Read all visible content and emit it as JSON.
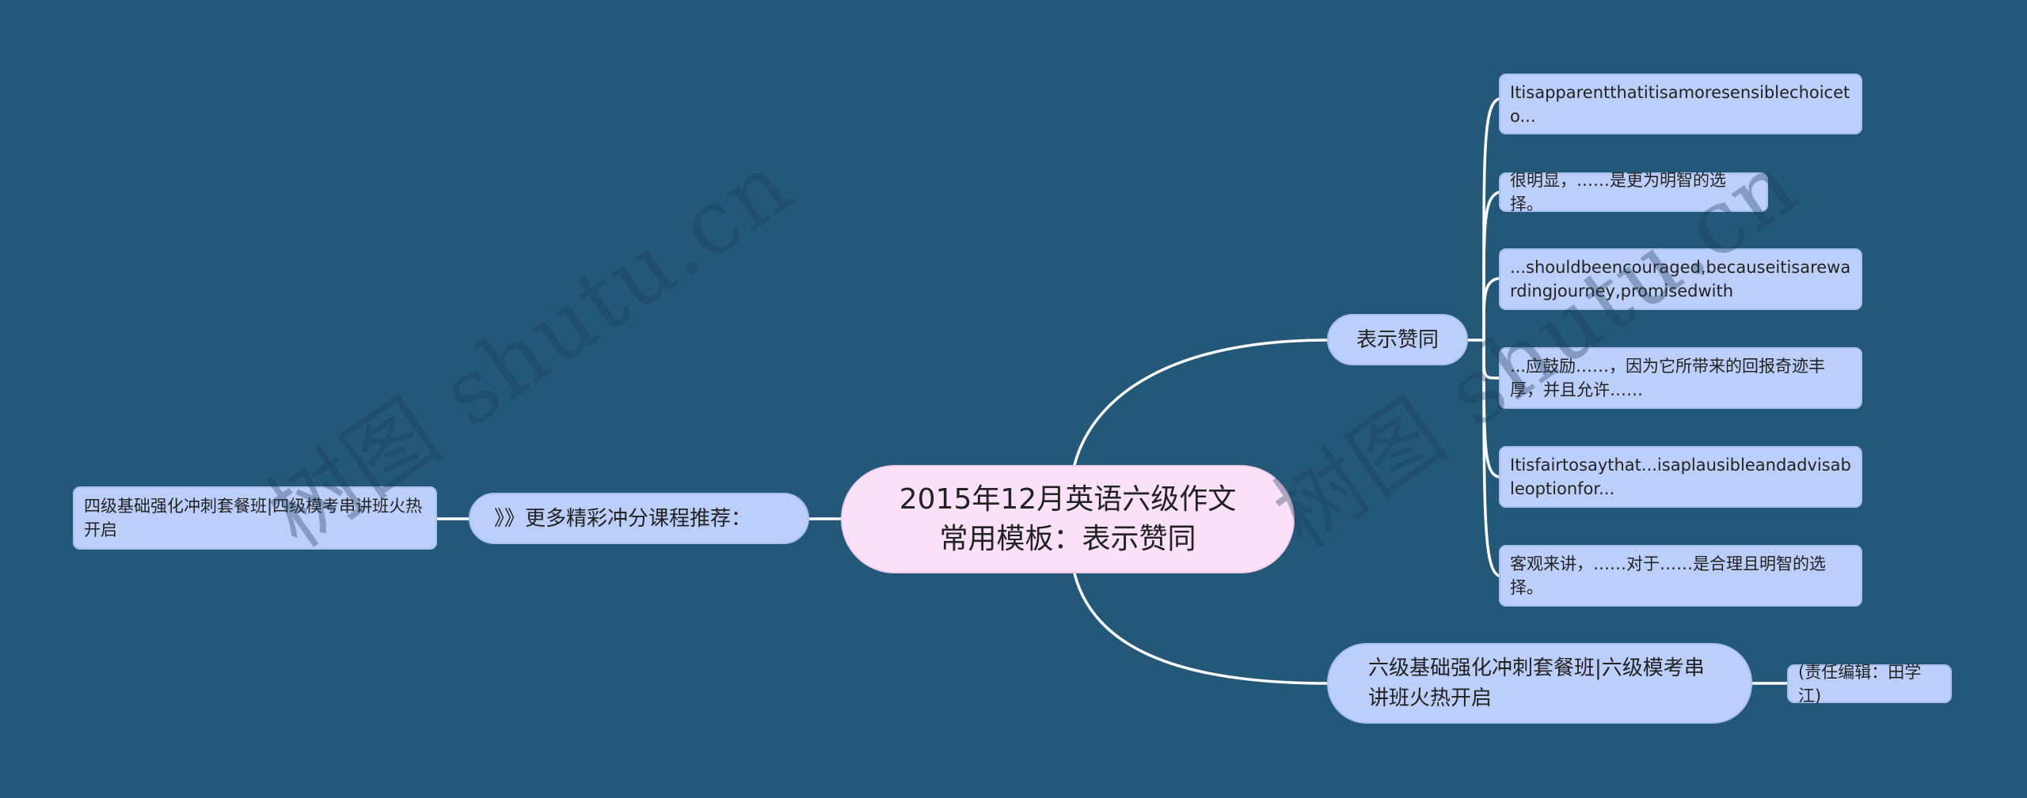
{
  "colors": {
    "background": "#235879",
    "root_fill": "#fbe1f8",
    "node_fill": "#bccffb",
    "connector": "#ffffff"
  },
  "watermark": {
    "text": "树图 shutu.cn"
  },
  "mindmap": {
    "root": {
      "label": "2015年12月英语六级作文常用模板：表示赞同"
    },
    "right_branches": [
      {
        "label": "表示赞同",
        "children": [
          {
            "label": "Itisapparentthatitisamoresensiblechoiceto..."
          },
          {
            "label": "很明显，……是更为明智的选择。"
          },
          {
            "label": "...shouldbeencouraged,becauseitisarewardingjourney,promisedwith"
          },
          {
            "label": "...应鼓励……，因为它所带来的回报奇迹丰厚，并且允许……"
          },
          {
            "label": "Itisfairtosaythat...isaplausibleandadvisableoptionfor..."
          },
          {
            "label": "客观来讲，……对于……是合理且明智的选择。"
          }
        ]
      },
      {
        "label": "六级基础强化冲刺套餐班|六级模考串讲班火热开启",
        "children": [
          {
            "label": "(责任编辑：田学江)"
          }
        ]
      }
    ],
    "left_branches": [
      {
        "label": "》》更多精彩冲分课程推荐：",
        "children": [
          {
            "label": "四级基础强化冲刺套餐班|四级模考串讲班火热开启"
          }
        ]
      }
    ]
  }
}
